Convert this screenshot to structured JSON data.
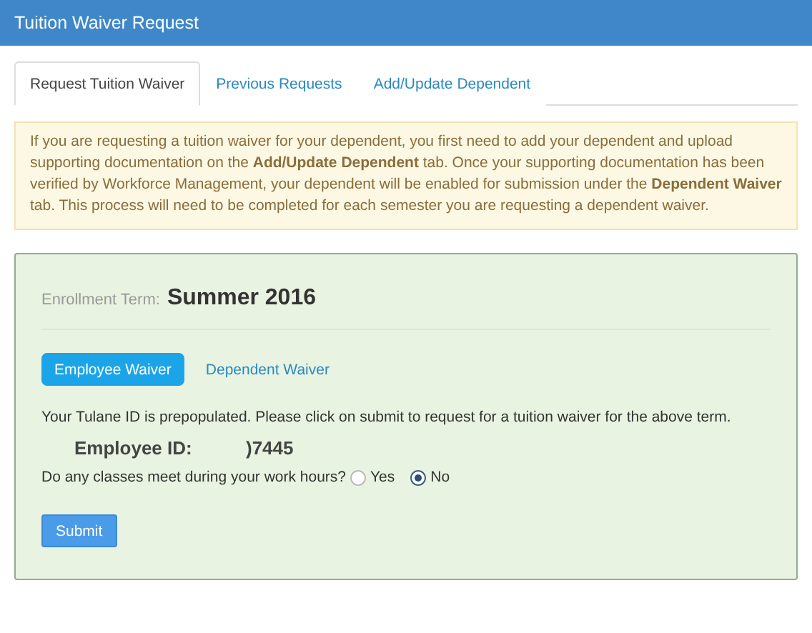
{
  "window": {
    "title": "Tuition Waiver Request"
  },
  "tabs": [
    {
      "label": "Request Tuition Waiver",
      "selected": true
    },
    {
      "label": "Previous Requests",
      "selected": false
    },
    {
      "label": "Add/Update Dependent",
      "selected": false
    }
  ],
  "notice": "If you are requesting a tuition waiver for your dependent, you first need to add your dependent and upload supporting documentation on the **Add/Update Dependent** tab. Once your supporting documentation has been verified by Workforce Management, your dependent will be enabled for submission under the **Dependent Waiver** tab. This process will need to be completed for each semester you are requesting a dependent waiver.",
  "form": {
    "term_label": "Enrollment Term:",
    "term_value": "Summer 2016",
    "pills": [
      {
        "label": "Employee Waiver",
        "selected": true
      },
      {
        "label": "Dependent Waiver",
        "selected": false
      }
    ],
    "info": "Your Tulane ID is prepopulated. Please click on submit to request for a tuition waiver for the above term.",
    "id_label": "Employee ID:",
    "id_value": ")7445",
    "question": "Do any classes meet during your work hours?",
    "options": [
      {
        "label": "Yes",
        "selected": false
      },
      {
        "label": "No",
        "selected": true
      }
    ],
    "submit": "Submit"
  }
}
